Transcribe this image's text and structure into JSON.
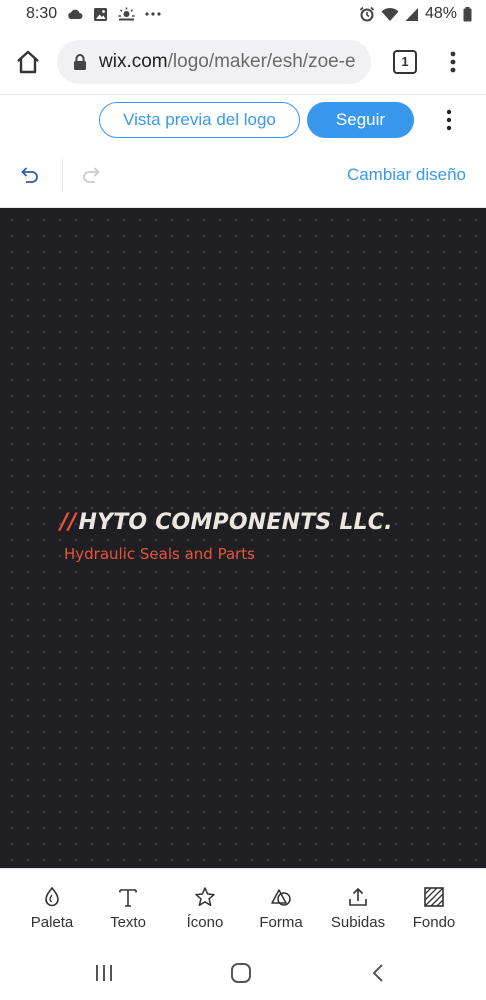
{
  "status_bar": {
    "time": "8:30",
    "battery": "48%",
    "left_icons": [
      "cloud-icon",
      "image-icon",
      "weather-icon",
      "more-dots-icon"
    ],
    "right_icons": [
      "alarm-icon",
      "wifi-icon",
      "signal-icon",
      "battery-icon"
    ]
  },
  "browser": {
    "url_domain": "wix.com",
    "url_path": "/logo/maker/esh/zoe-e",
    "tab_count": "1"
  },
  "header": {
    "preview_label": "Vista previa del logo",
    "follow_label": "Seguir"
  },
  "toolbar": {
    "change_design_label": "Cambiar diseño"
  },
  "logo": {
    "slashes": "//",
    "title": "HYTO COMPONENTS LLC.",
    "tagline": "Hydraulic Seals and Parts",
    "accent_color": "#e8533a",
    "text_color": "#ece6df",
    "background_color": "#1f1f23"
  },
  "bottom_tools": [
    {
      "label": "Paleta",
      "icon": "palette-drop-icon"
    },
    {
      "label": "Texto",
      "icon": "text-icon"
    },
    {
      "label": "Ícono",
      "icon": "star-icon"
    },
    {
      "label": "Forma",
      "icon": "shapes-icon"
    },
    {
      "label": "Subidas",
      "icon": "upload-icon"
    },
    {
      "label": "Fondo",
      "icon": "background-pattern-icon"
    }
  ],
  "colors": {
    "accent_blue": "#3899ec"
  }
}
